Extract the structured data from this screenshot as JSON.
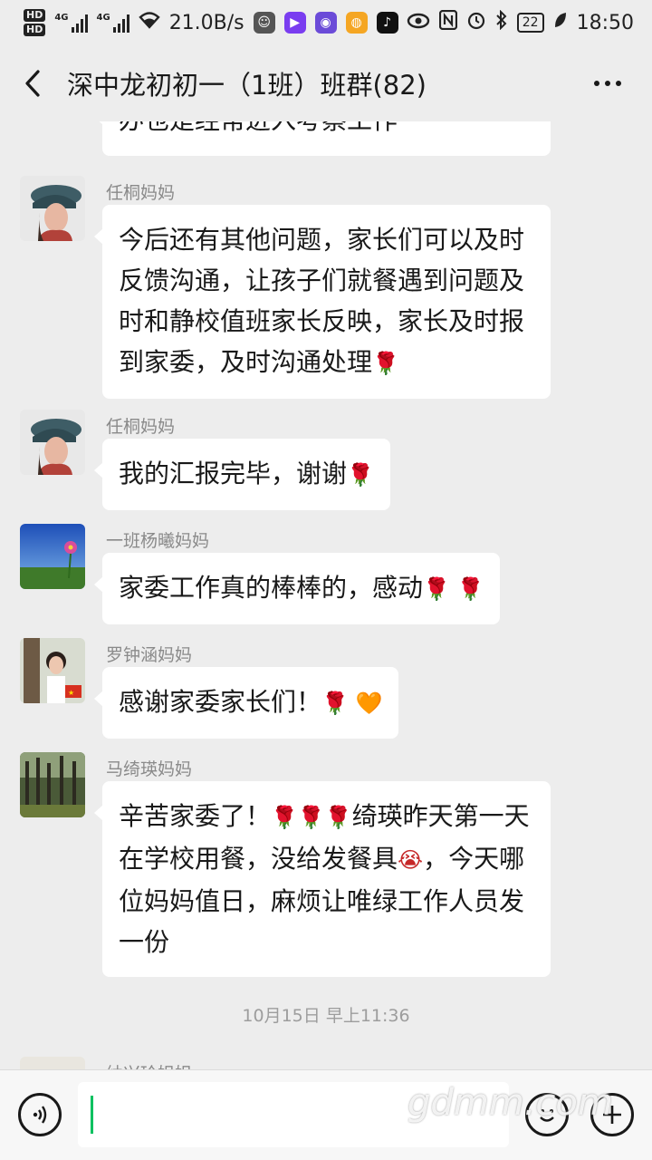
{
  "status_bar": {
    "hd1": "HD",
    "hd2": "HD",
    "net1": "4G",
    "net2": "4G",
    "speed": "21.0B/s",
    "battery": "22",
    "time": "18:50"
  },
  "header": {
    "title": "深中龙初初一（1班）班群(82)"
  },
  "messages": [
    {
      "sender": "",
      "text": "办也是经常进入考察工作"
    },
    {
      "sender": "任桐妈妈",
      "text": "今后还有其他问题，家长们可以及时反馈沟通，让孩子们就餐遇到问题及时和静校值班家长反映，家长及时报到家委，及时沟通处理",
      "emoji": "🌹"
    },
    {
      "sender": "任桐妈妈",
      "text": "我的汇报完毕，谢谢",
      "emoji": "🌹"
    },
    {
      "sender": "一班杨曦妈妈",
      "text": "家委工作真的棒棒的，感动",
      "emoji": "🌹 🌹"
    },
    {
      "sender": "罗钟涵妈妈",
      "text": "感谢家委家长们！",
      "emoji": "🌹 🧡"
    },
    {
      "sender": "马绮瑛妈妈",
      "text_a": "辛苦家委了！",
      "emoji_a": "🌹🌹🌹",
      "text_b": "绮瑛昨天第一天在学校用餐，没给发餐具",
      "emoji_b": "😭",
      "text_c": "，今天哪位妈妈值日，麻烦让唯绿工作人员发一份"
    },
    {
      "sender": "纳兴玲姐姐"
    }
  ],
  "timestamp": "10月15日 早上11:36",
  "watermark": "gdmm.com",
  "colors": {
    "background": "#ededed",
    "bubble": "#ffffff",
    "caret": "#07c160"
  }
}
